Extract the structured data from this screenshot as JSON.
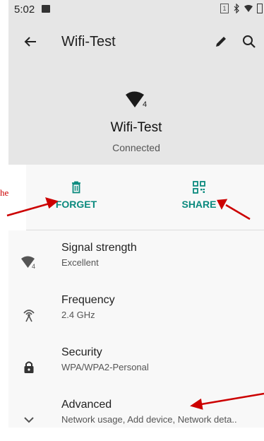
{
  "status_bar": {
    "time": "5:02",
    "sim_label": "1"
  },
  "appbar": {
    "title": "Wifi-Test",
    "back_icon": "arrow-back-icon",
    "edit_icon": "pencil-icon",
    "search_icon": "search-icon"
  },
  "header": {
    "network_name": "Wifi-Test",
    "status": "Connected",
    "signal_level": "4"
  },
  "actions": {
    "forget_label": "FORGET",
    "share_label": "SHARE"
  },
  "annotation": {
    "text": "he"
  },
  "details": [
    {
      "title": "Signal strength",
      "value": "Excellent",
      "icon": "wifi-signal-icon",
      "badge": "4"
    },
    {
      "title": "Frequency",
      "value": "2.4 GHz",
      "icon": "antenna-icon"
    },
    {
      "title": "Security",
      "value": "WPA/WPA2-Personal",
      "icon": "lock-icon"
    },
    {
      "title": "Advanced",
      "value": "Network usage, Add device, Network deta..",
      "icon": "chevron-down-icon"
    }
  ],
  "colors": {
    "accent": "#0b8a7e",
    "header_bg": "#e6e6e6",
    "annotation": "#cc0000"
  }
}
